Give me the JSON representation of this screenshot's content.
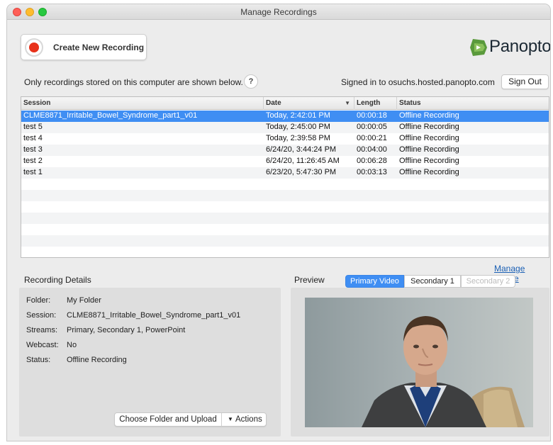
{
  "window": {
    "title": "Manage Recordings"
  },
  "toolbar": {
    "create_label": "Create New Recording"
  },
  "brand": {
    "logo_text": "Panopto",
    "logo_color": "#5a9a3c"
  },
  "info": {
    "local_note": "Only recordings stored on this computer are shown below.",
    "help_label": "?",
    "signed_in": "Signed in to osuchs.hosted.panopto.com",
    "sign_out_label": "Sign Out"
  },
  "table": {
    "columns": {
      "session": "Session",
      "date": "Date",
      "length": "Length",
      "status": "Status"
    },
    "selected_color": "#3f8ef3",
    "rows": [
      {
        "session": "CLME8871_Irritable_Bowel_Syndrome_part1_v01",
        "date": "Today, 2:42:01 PM",
        "length": "00:00:18",
        "status": "Offline Recording",
        "selected": true
      },
      {
        "session": "test 5",
        "date": "Today, 2:45:00 PM",
        "length": "00:00:05",
        "status": "Offline Recording"
      },
      {
        "session": "test 4",
        "date": "Today, 2:39:58 PM",
        "length": "00:00:21",
        "status": "Offline Recording"
      },
      {
        "session": "test 3",
        "date": "6/24/20, 3:44:24 PM",
        "length": "00:04:00",
        "status": "Offline Recording"
      },
      {
        "session": "test 2",
        "date": "6/24/20, 11:26:45 AM",
        "length": "00:06:28",
        "status": "Offline Recording"
      },
      {
        "session": "test 1",
        "date": "6/23/20, 5:47:30 PM",
        "length": "00:03:13",
        "status": "Offline Recording"
      }
    ]
  },
  "manage_online": "Manage Online",
  "details": {
    "title": "Recording Details",
    "folder_label": "Folder:",
    "folder_value": "My Folder",
    "session_label": "Session:",
    "session_value": "CLME8871_Irritable_Bowel_Syndrome_part1_v01",
    "streams_label": "Streams:",
    "streams_value": "Primary, Secondary 1, PowerPoint",
    "webcast_label": "Webcast:",
    "webcast_value": "No",
    "status_label": "Status:",
    "status_value": "Offline Recording",
    "upload_label": "Choose Folder and Upload",
    "actions_label": "Actions"
  },
  "preview": {
    "title": "Preview",
    "tabs": {
      "primary": "Primary Video",
      "secondary1": "Secondary 1",
      "secondary2": "Secondary 2"
    }
  }
}
